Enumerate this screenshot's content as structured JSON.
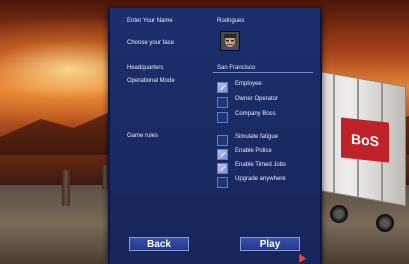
{
  "form": {
    "name_label": "Enter Your Name",
    "name_value": "Rodrigues",
    "face_label": "Choose your face",
    "hq_label": "Headquarters",
    "hq_value": "San Francisco",
    "mode_label": "Operational Mode",
    "modes": [
      {
        "label": "Employee",
        "checked": true
      },
      {
        "label": "Owner Operator",
        "checked": false
      },
      {
        "label": "Company Boss",
        "checked": false
      }
    ],
    "rules_label": "Game rules",
    "rules": [
      {
        "label": "Simulate fatigue",
        "checked": false
      },
      {
        "label": "Enable Police",
        "checked": true
      },
      {
        "label": "Enable Timed Jobs",
        "checked": true
      },
      {
        "label": "Upgrade anywhere",
        "checked": false
      }
    ]
  },
  "buttons": {
    "back": "Back",
    "play": "Play"
  },
  "scene": {
    "trailer_logo": "BoS"
  },
  "colors": {
    "panel": "#1c2f6c",
    "checkbox_on": "#9aa8e0",
    "text": "#e8ecff"
  }
}
